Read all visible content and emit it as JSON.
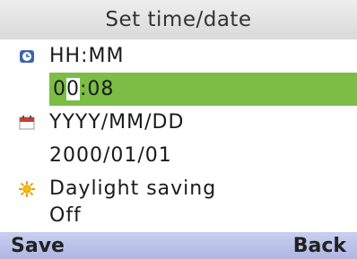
{
  "header": {
    "title": "Set time/date"
  },
  "time": {
    "label": "HH:MM",
    "value_before_cursor": "0",
    "value_cursor_char": "0",
    "value_after_cursor": ":08",
    "icon": "clock-icon"
  },
  "date": {
    "label": "YYYY/MM/DD",
    "value": "2000/01/01",
    "icon": "calendar-icon"
  },
  "dst": {
    "label": "Daylight saving",
    "value": "Off",
    "icon": "sun-icon"
  },
  "softkeys": {
    "left": "Save",
    "right": "Back"
  },
  "colors": {
    "selection": "#7cbd45",
    "softkey_bar": "#b7bfe8",
    "header": "#e3e3e3"
  }
}
